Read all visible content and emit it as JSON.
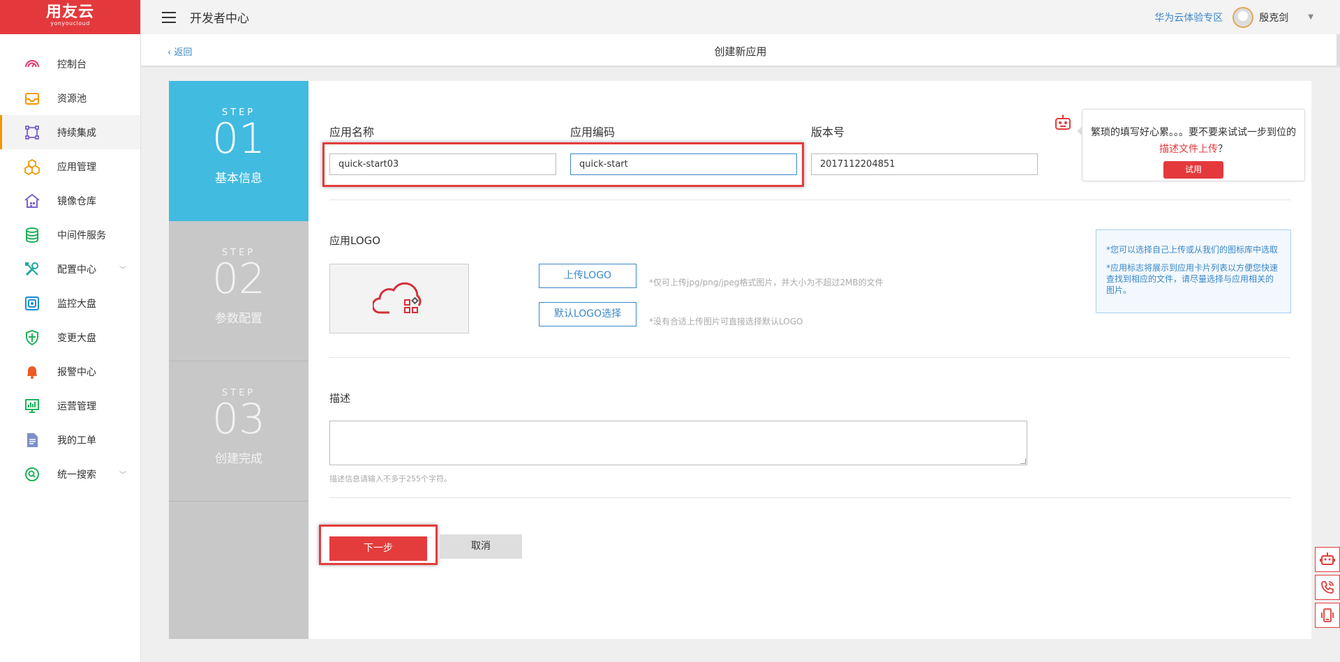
{
  "brand": {
    "name": "用友云",
    "sub": "yonyoucloud",
    "color": "#e4393c"
  },
  "header": {
    "title": "开发者中心",
    "promo_link": "华为云体验专区",
    "username": "殷克剑",
    "dropdown_icon": "▼"
  },
  "breadcrumb": {
    "back_label": "返回",
    "page_title": "创建新应用"
  },
  "sidebar": {
    "items": [
      {
        "label": "控制台",
        "icon": "dashboard-icon"
      },
      {
        "label": "资源池",
        "icon": "inbox-icon"
      },
      {
        "label": "持续集成",
        "icon": "integration-icon",
        "active": true
      },
      {
        "label": "应用管理",
        "icon": "cubes-icon"
      },
      {
        "label": "镜像仓库",
        "icon": "warehouse-icon"
      },
      {
        "label": "中间件服务",
        "icon": "database-icon"
      },
      {
        "label": "配置中心",
        "icon": "tools-icon",
        "expandable": true
      },
      {
        "label": "监控大盘",
        "icon": "monitor-icon"
      },
      {
        "label": "变更大盘",
        "icon": "shield-icon"
      },
      {
        "label": "报警中心",
        "icon": "bell-icon"
      },
      {
        "label": "运营管理",
        "icon": "chart-icon"
      },
      {
        "label": "我的工单",
        "icon": "document-icon"
      },
      {
        "label": "统一搜索",
        "icon": "search-icon",
        "expandable": true
      }
    ]
  },
  "steps": [
    {
      "label": "STEP",
      "number": "01",
      "name": "基本信息",
      "active": true
    },
    {
      "label": "STEP",
      "number": "02",
      "name": "参数配置",
      "active": false
    },
    {
      "label": "STEP",
      "number": "03",
      "name": "创建完成",
      "active": false
    }
  ],
  "form": {
    "app_name": {
      "label": "应用名称",
      "value": "quick-start03"
    },
    "app_code": {
      "label": "应用编码",
      "value": "quick-start"
    },
    "version": {
      "label": "版本号",
      "value": "2017112204851"
    },
    "robot_tip": {
      "line1": "繁琐的填写好心累。。。要不要来试试一步到位的",
      "link": "描述文件上传",
      "suffix": "？",
      "try_label": "试用"
    },
    "logo": {
      "label": "应用LOGO",
      "upload_label": "上传LOGO",
      "upload_hint": "*仅可上传jpg/png/jpeg格式图片，并大小为不超过2MB的文件",
      "default_label": "默认LOGO选择",
      "default_hint": "*没有合适上传图片可直接选择默认LOGO",
      "info1": "*您可以选择自己上传或从我们的图标库中选取",
      "info2": "*应用标志将展示到应用卡片列表以方便您快速查找到相应的文件，请尽量选择与应用相关的图片。"
    },
    "description": {
      "label": "描述",
      "value": "",
      "hint": "描述信息请输入不多于255个字符。"
    },
    "next_label": "下一步",
    "cancel_label": "取消"
  },
  "colors": {
    "accent_red": "#e43c3c",
    "step_active": "#42bbe0",
    "link_blue": "#3b87c8",
    "sidebar_active_bar": "#f29700"
  },
  "float_tools": [
    "robot-icon",
    "phone-icon",
    "mobile-icon"
  ]
}
